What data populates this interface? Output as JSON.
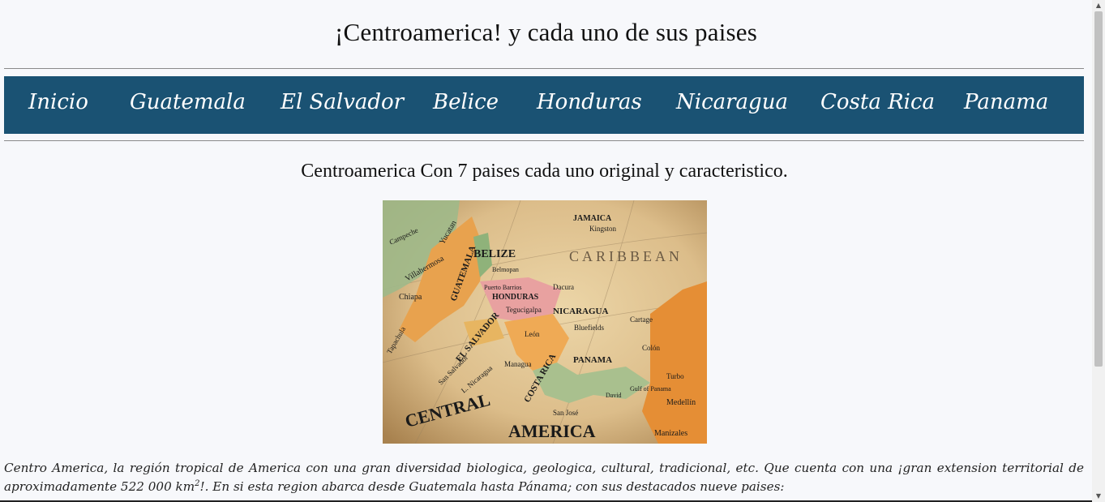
{
  "header": {
    "title": "¡Centroamerica! y cada uno de sus paises"
  },
  "nav": {
    "items": [
      "Inicio",
      "Guatemala",
      "El Salvador",
      "Belice",
      "Honduras",
      "Nicaragua",
      "Costa Rica",
      "Panama"
    ]
  },
  "main": {
    "subtitle": "Centroamerica Con 7 paises cada uno original y caracteristico.",
    "map_labels": [
      "CARIBBEAN",
      "BELIZE",
      "GUATEMALA",
      "HONDURAS",
      "EL SALVADOR",
      "NICARAGUA",
      "COSTA RICA",
      "PANAMA",
      "CENTRAL",
      "AMERICA",
      "JAMAICA",
      "Tegucigalpa",
      "Managua",
      "Bluefields",
      "San Salvador",
      "Villahermosa",
      "Chiapa",
      "Campeche",
      "Kingston",
      "Dacura",
      "Belmopan",
      "Puerto Barrios",
      "L. Nicaragua",
      "San José",
      "Colón",
      "Turbo",
      "Medellín",
      "Manizales",
      "Cartage",
      "Tapachula",
      "Gulf of Panama",
      "David",
      "León",
      "Yucatan"
    ],
    "para_text_1": "Centro America, la región tropical de America con una gran diversidad biologica, geologica, cultural, tradicional, etc. Que cuenta con una ¡gran extension territorial de aproximadamente 522 000 km",
    "para_sup": "2",
    "para_text_2": "!. En si esta region abarca desde Guatemala hasta Pánama; con sus destacados nueve paises:"
  },
  "scrollbar": {
    "up_icon": "▲",
    "down_icon": "▼"
  }
}
